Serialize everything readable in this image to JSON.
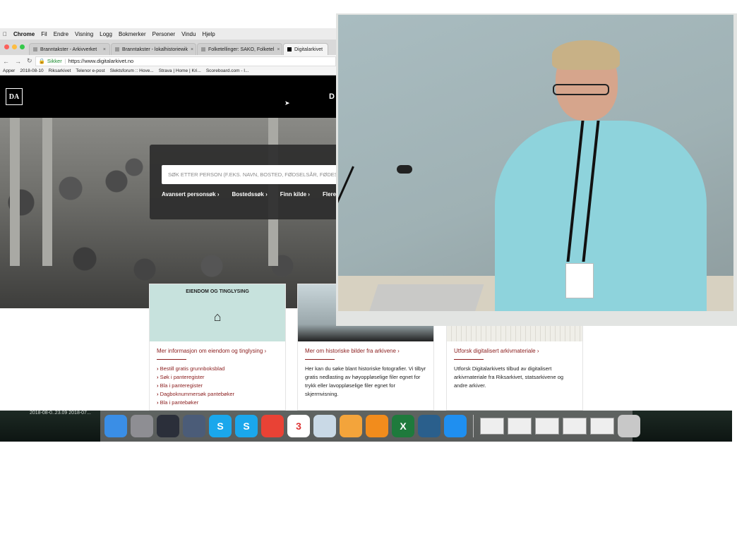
{
  "menubar": {
    "apple_icon": "apple-icon",
    "app": "Chrome",
    "items": [
      "Fil",
      "Endre",
      "Visning",
      "Logg",
      "Bokmerker",
      "Personer",
      "Vindu",
      "Hjelp"
    ]
  },
  "tabs": [
    {
      "label": "Branntakster - Arkivverket",
      "active": false
    },
    {
      "label": "Branntakster - lokalhistoriewik",
      "active": false
    },
    {
      "label": "Folketellinger: SAKO, Folketel",
      "active": false
    },
    {
      "label": "Digitalarkivet",
      "active": true
    }
  ],
  "address": {
    "secure_label": "Sikker",
    "url": "https://www.digitalarkivet.no"
  },
  "bookmarks": [
    "Apper",
    "2018-08-10",
    "Riksarkivet",
    "Telenor e-post",
    "Slektsforum :: Hove...",
    "Strava | Home | Kri...",
    "Scoreboard.com - I..."
  ],
  "site": {
    "logo": "DA",
    "header_letter": "D",
    "search_placeholder": "SØK ETTER PERSON (F.EKS. NAVN, BOSTED, FØDSELSÅR, FØDESTED)",
    "search_links": [
      "Avansert personsøk ›",
      "Bostedssøk ›",
      "Finn kilde ›",
      "Flere søk ›"
    ]
  },
  "cards": [
    {
      "title": "EIENDOM OG TINGLYSING",
      "link": "Mer informasjon om eiendom og tinglysing ›",
      "items": [
        "Bestill gratis grunnboksblad",
        "Søk i panteregister",
        "Bla i panteregister",
        "Dagboknummersøk pantebøker",
        "Bla i pantebøker"
      ]
    },
    {
      "title": "",
      "link": "Mer om historiske bilder fra arkivene ›",
      "desc": "Her kan du søke blant historiske fotografier. Vi tilbyr gratis nedlasting av høyoppløselige filer egnet for trykk eller lavoppløselige filer egnet for skjermvisning."
    },
    {
      "title": "",
      "link": "Utforsk digitalisert arkivmateriale ›",
      "desc": "Utforsk Digitalarkivets tilbud av digitalisert arkivmateriale fra Riksarkivet, statsarkivene og andre arkiver."
    }
  ],
  "desktop": {
    "date_text": "2018-08-0..23.09   2018-07..."
  },
  "dock": [
    {
      "name": "finder-icon",
      "color": "#3a8ee6"
    },
    {
      "name": "launchpad-icon",
      "color": "#8e8e93"
    },
    {
      "name": "mission-control-icon",
      "color": "#2b2f3a"
    },
    {
      "name": "x11-icon",
      "color": "#4b5c78"
    },
    {
      "name": "skype-icon",
      "color": "#1aa7ec",
      "glyph": "S"
    },
    {
      "name": "skype-icon",
      "color": "#1aa7ec",
      "glyph": "S"
    },
    {
      "name": "chrome-icon",
      "color": "#e94235"
    },
    {
      "name": "calendar-icon",
      "color": "#ffffff",
      "glyph": "3"
    },
    {
      "name": "preview-icon",
      "color": "#c9d9e6"
    },
    {
      "name": "photos-icon",
      "color": "#f3a43b"
    },
    {
      "name": "ibooks-icon",
      "color": "#f28c1c"
    },
    {
      "name": "excel-icon",
      "color": "#1e7a3c",
      "glyph": "X"
    },
    {
      "name": "mysql-workbench-icon",
      "color": "#2a5f8c"
    },
    {
      "name": "safari-icon",
      "color": "#1f8ff0"
    }
  ],
  "colors": {
    "accent": "#8a1c1c",
    "card_head": "#c7e2dd",
    "site_header": "#000000"
  }
}
